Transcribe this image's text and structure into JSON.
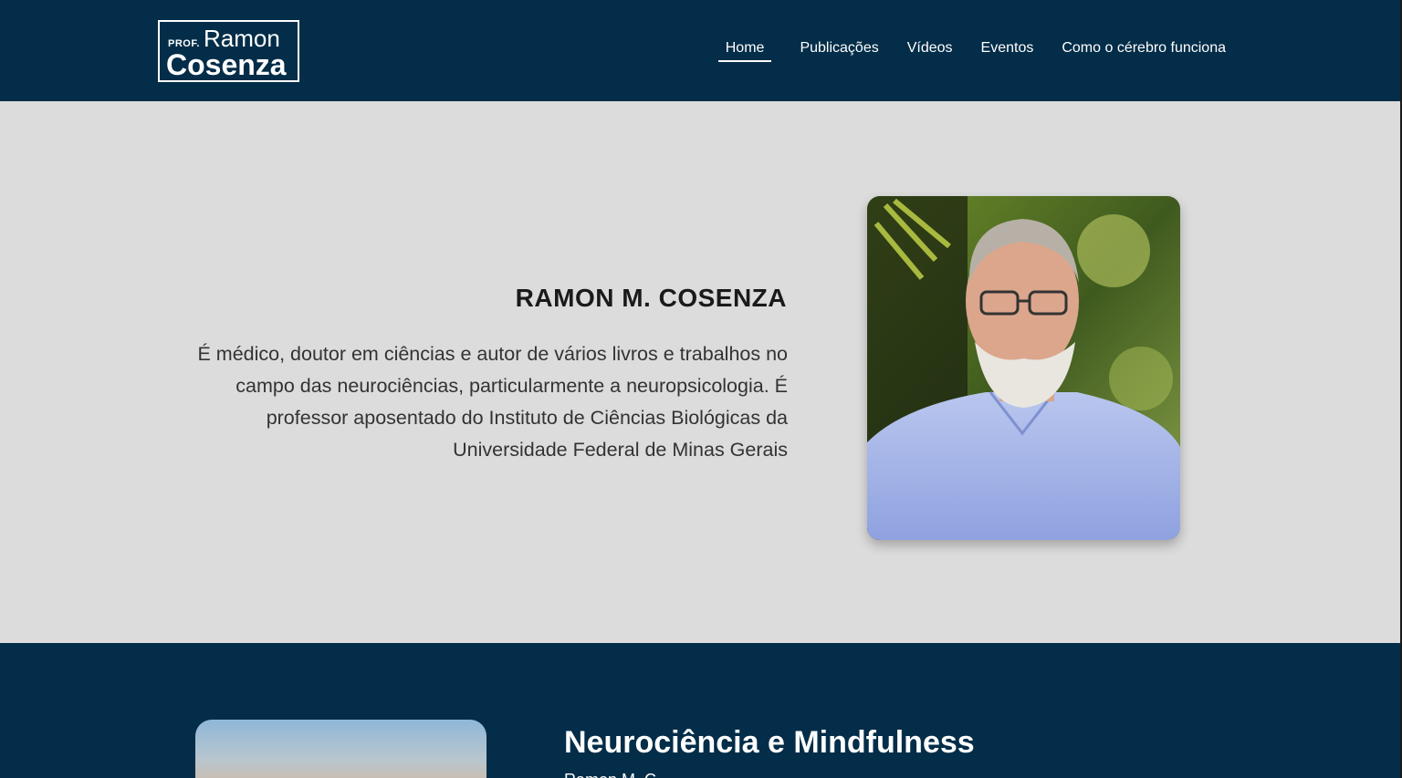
{
  "header": {
    "logo": {
      "prof": "PROF.",
      "first_name": "Ramon",
      "last_name": "Cosenza"
    },
    "nav": [
      {
        "label": "Home",
        "active": true
      },
      {
        "label": "Publicações",
        "active": false
      },
      {
        "label": "Vídeos",
        "active": false
      },
      {
        "label": "Eventos",
        "active": false
      },
      {
        "label": "Como o cérebro funciona",
        "active": false
      }
    ]
  },
  "hero": {
    "name": "RAMON M. COSENZA",
    "bio": "É médico, doutor em ciências e autor de vários livros e trabalhos no campo das neurociências, particularmente a neuropsicologia. É professor aposentado do Instituto de Ciências Biológicas da Universidade Federal de Minas Gerais"
  },
  "featured": {
    "title": "Neurociência e Mindfulness",
    "subtitle": "Ramon M. C"
  },
  "colors": {
    "navy": "#032d48",
    "hero_bg": "#dcdcdc",
    "text_dark": "#1a1a1a",
    "text_body": "#333333"
  }
}
